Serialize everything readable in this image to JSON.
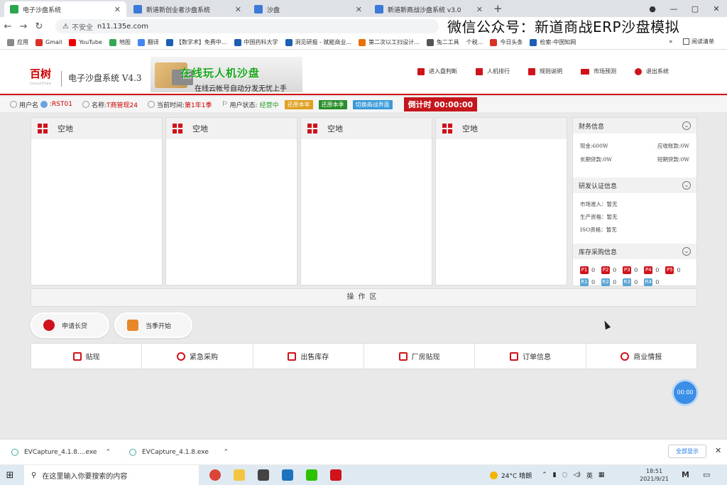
{
  "browser": {
    "tabs": [
      {
        "label": "电子沙盘系统",
        "color": "#2da44e"
      },
      {
        "label": "新道新创业者沙盘系统",
        "color": "#3b7ad8"
      },
      {
        "label": "沙盘",
        "color": "#3b7ad8"
      },
      {
        "label": "新道新商战沙盘系统 v3.0",
        "color": "#3b7ad8"
      }
    ],
    "new_tab": "+",
    "address": {
      "security": "不安全",
      "url": "n11.135e.com"
    },
    "bookmarks": [
      {
        "label": "应用",
        "color": "#555"
      },
      {
        "label": "Gmail",
        "color": "#d93025"
      },
      {
        "label": "YouTube",
        "color": "#e00"
      },
      {
        "label": "地图",
        "color": "#34a853"
      },
      {
        "label": "翻译",
        "color": "#4285f4"
      },
      {
        "label": "【数学术】免费中...",
        "color": "#1a5fb4"
      },
      {
        "label": "中国药科大学",
        "color": "#1a5fb4"
      },
      {
        "label": "洞见研报 - 赋能商业...",
        "color": "#1a5fb4"
      },
      {
        "label": "第二次以工扫设计...",
        "color": "#e8710a"
      },
      {
        "label": "兔二工具",
        "color": "#555"
      },
      {
        "label": "个税...",
        "color": "#999"
      },
      {
        "label": "今日头条",
        "color": "#d93025"
      },
      {
        "label": "检索-中国知网",
        "color": "#1a5fb4"
      }
    ],
    "bookmarks_more": "»",
    "reading_list": "阅读清单"
  },
  "watermark": "微信公众号：新道商战ERP沙盘模拟",
  "app": {
    "logo": "百树",
    "logo_en": "GreatTree",
    "title": "电子沙盘系统 V4.3",
    "banner_main": "在线玩人机沙盘",
    "banner_sub": "在线云帐号自动分发无忧上手",
    "nav": [
      {
        "label": "进入盘判断",
        "icon": "door-icon"
      },
      {
        "label": "人机排行",
        "icon": "ranking-icon"
      },
      {
        "label": "规则说明",
        "icon": "book-icon"
      },
      {
        "label": "市场预测",
        "icon": "mail-icon"
      },
      {
        "label": "退出系统",
        "icon": "exit-icon"
      }
    ]
  },
  "info": {
    "user_label": "用户名",
    "user_value": ":RST01",
    "name_label": "名称:",
    "name_value": "T商管现24",
    "time_label": "当前时间:",
    "time_value": "第1年1季",
    "status_label": "用户状态:",
    "status_value": "经营中",
    "btn_year": {
      "label": "还原本年",
      "color": "#e0a020"
    },
    "btn_quarter": {
      "label": "还原本季",
      "color": "#2a8f2a"
    },
    "btn_switch": {
      "label": "切换商战界面",
      "color": "#3a9ad9"
    },
    "countdown": "倒计时 00:00:00"
  },
  "plots": [
    {
      "label": "空地"
    },
    {
      "label": "空地"
    },
    {
      "label": "空地"
    },
    {
      "label": "空地"
    }
  ],
  "sidebar": {
    "finance": {
      "title": "财务信息",
      "cash": "现金:600W",
      "receivable": "应收账款:0W",
      "long_loan": "长期贷款:0W",
      "short_loan": "短期贷款:0W"
    },
    "rd": {
      "title": "研发认证信息",
      "market": "市场准入：暂无",
      "production": "生产资格：暂无",
      "iso": "ISO资格：暂无"
    },
    "inventory": {
      "title": "库存采购信息",
      "products": [
        {
          "code": "P1",
          "qty": "0"
        },
        {
          "code": "P2",
          "qty": "0"
        },
        {
          "code": "P3",
          "qty": "0"
        },
        {
          "code": "P4",
          "qty": "0"
        },
        {
          "code": "P5",
          "qty": "0"
        }
      ],
      "materials": [
        {
          "code": "R1",
          "qty": "0"
        },
        {
          "code": "R2",
          "qty": "0"
        },
        {
          "code": "R3",
          "qty": "0"
        },
        {
          "code": "R4",
          "qty": "0"
        }
      ]
    }
  },
  "op_zone": "操作区",
  "pills": [
    {
      "label": "申请长贷",
      "color": "#d0121b"
    },
    {
      "label": "当季开始",
      "color": "#e8872a"
    }
  ],
  "actions": [
    {
      "label": "贴现",
      "icon": "discount-icon"
    },
    {
      "label": "紧急采购",
      "icon": "urgent-purchase-icon"
    },
    {
      "label": "出售库存",
      "icon": "sell-stock-icon"
    },
    {
      "label": "厂房贴现",
      "icon": "factory-discount-icon"
    },
    {
      "label": "订单信息",
      "icon": "order-info-icon"
    },
    {
      "label": "商业情报",
      "icon": "intel-icon"
    }
  ],
  "timer": "00:00",
  "downloads": [
    {
      "name": "EVCapture_4.1.8....exe"
    },
    {
      "name": "EVCapture_4.1.8.exe"
    }
  ],
  "show_all": "全部显示",
  "taskbar": {
    "search_placeholder": "在这里输入你要搜索的内容",
    "apps": [
      {
        "icon": "chrome-icon",
        "color": "#db4437"
      },
      {
        "icon": "explorer-icon",
        "color": "#f4c542"
      },
      {
        "icon": "store-icon",
        "color": "#444"
      },
      {
        "icon": "mail-app-icon",
        "color": "#1e73be"
      },
      {
        "icon": "wechat-icon",
        "color": "#2dc100"
      },
      {
        "icon": "wps-icon",
        "color": "#d0121b"
      }
    ],
    "weather": "24°C 晴朗",
    "ime": "英",
    "time": "18:51",
    "date": "2021/9/21"
  }
}
